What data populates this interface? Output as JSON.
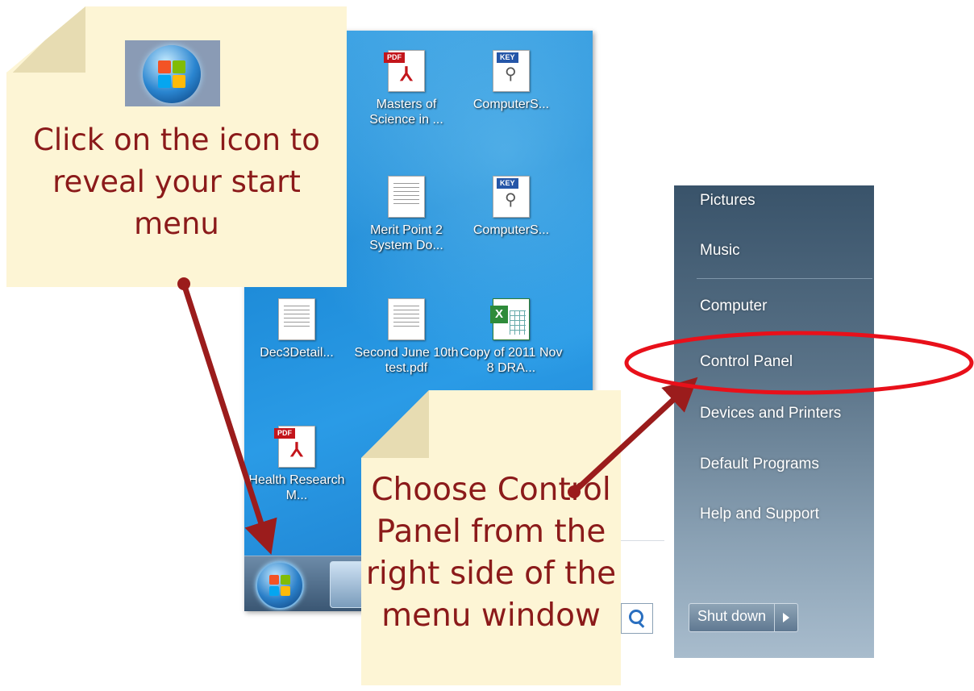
{
  "desktop": {
    "icons": [
      {
        "label": "Masters of Science in ...",
        "type": "pdf",
        "tag": "PDF"
      },
      {
        "label": "ComputerS...",
        "type": "key",
        "tag": "KEY"
      },
      {
        "label": "Merit Point 2 System Do...",
        "type": "doc"
      },
      {
        "label": "ComputerS...",
        "type": "key",
        "tag": "KEY"
      },
      {
        "label": "Dec3Detail...",
        "type": "doc"
      },
      {
        "label": "Second June 10th test.pdf",
        "type": "doc"
      },
      {
        "label": "Copy of 2011 Nov 8 DRA...",
        "type": "xls"
      },
      {
        "label": "Health Research M...",
        "type": "pdf",
        "tag": "PDF"
      }
    ]
  },
  "start_menu": {
    "items": [
      "Pictures",
      "Music",
      "Computer",
      "Control Panel",
      "Devices and Printers",
      "Default Programs",
      "Help and Support"
    ],
    "shutdown_label": "Shut down"
  },
  "notes": {
    "note1": "Click on the icon to reveal your start menu",
    "note2": "Choose Control Panel from the right side of the menu window"
  },
  "colors": {
    "note_text": "#8b1a1a",
    "arrow": "#9b1c1c",
    "highlight_ellipse": "#e8101a",
    "note_bg": "#fdf5d5"
  }
}
